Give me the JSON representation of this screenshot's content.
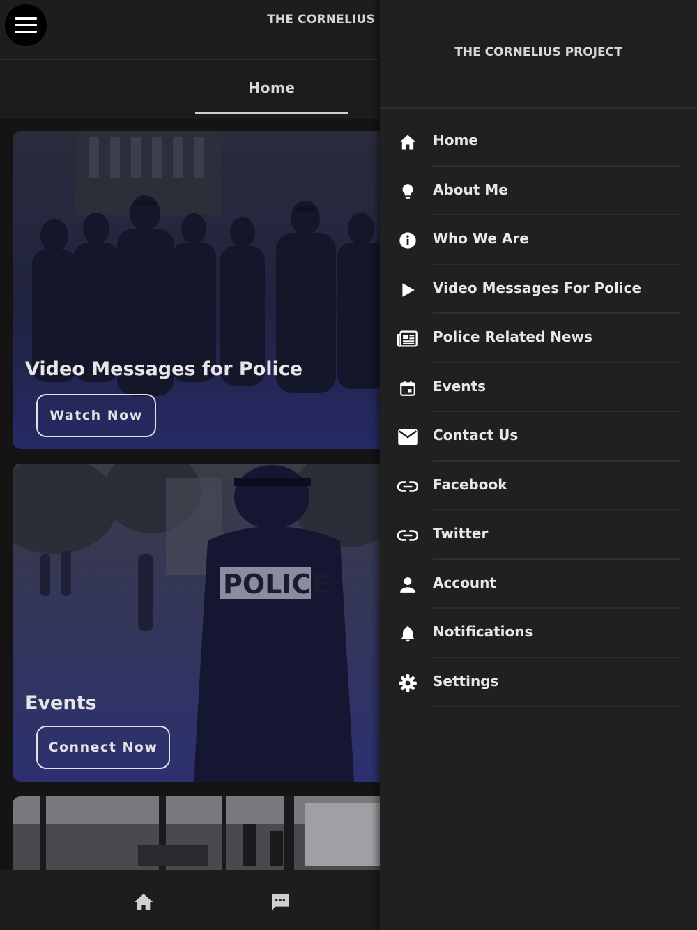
{
  "header": {
    "title": "THE CORNELIUS P"
  },
  "tabs": [
    {
      "label": "Home",
      "active": true
    }
  ],
  "cards": [
    {
      "title": "Video Messages for Police",
      "button": "Watch Now"
    },
    {
      "title": "Events",
      "button": "Connect Now"
    }
  ],
  "bottom_nav": [
    {
      "icon": "home-icon"
    },
    {
      "icon": "chat-icon"
    }
  ],
  "drawer": {
    "title": "THE CORNELIUS PROJECT",
    "items": [
      {
        "label": "Home",
        "icon": "home-icon"
      },
      {
        "label": "About Me",
        "icon": "lightbulb-icon"
      },
      {
        "label": "Who We Are",
        "icon": "info-icon"
      },
      {
        "label": "Video Messages For Police",
        "icon": "play-icon"
      },
      {
        "label": "Police Related News",
        "icon": "newspaper-icon"
      },
      {
        "label": "Events",
        "icon": "calendar-icon"
      },
      {
        "label": "Contact Us",
        "icon": "mail-icon"
      },
      {
        "label": "Facebook",
        "icon": "link-icon"
      },
      {
        "label": "Twitter",
        "icon": "link-icon"
      },
      {
        "label": "Account",
        "icon": "person-icon"
      },
      {
        "label": "Notifications",
        "icon": "bell-icon"
      },
      {
        "label": "Settings",
        "icon": "gear-icon"
      }
    ]
  },
  "colors": {
    "background": "#141415",
    "drawer": "#202021",
    "card_tint": "#2a2d5a",
    "text": "#e8e8e8"
  }
}
